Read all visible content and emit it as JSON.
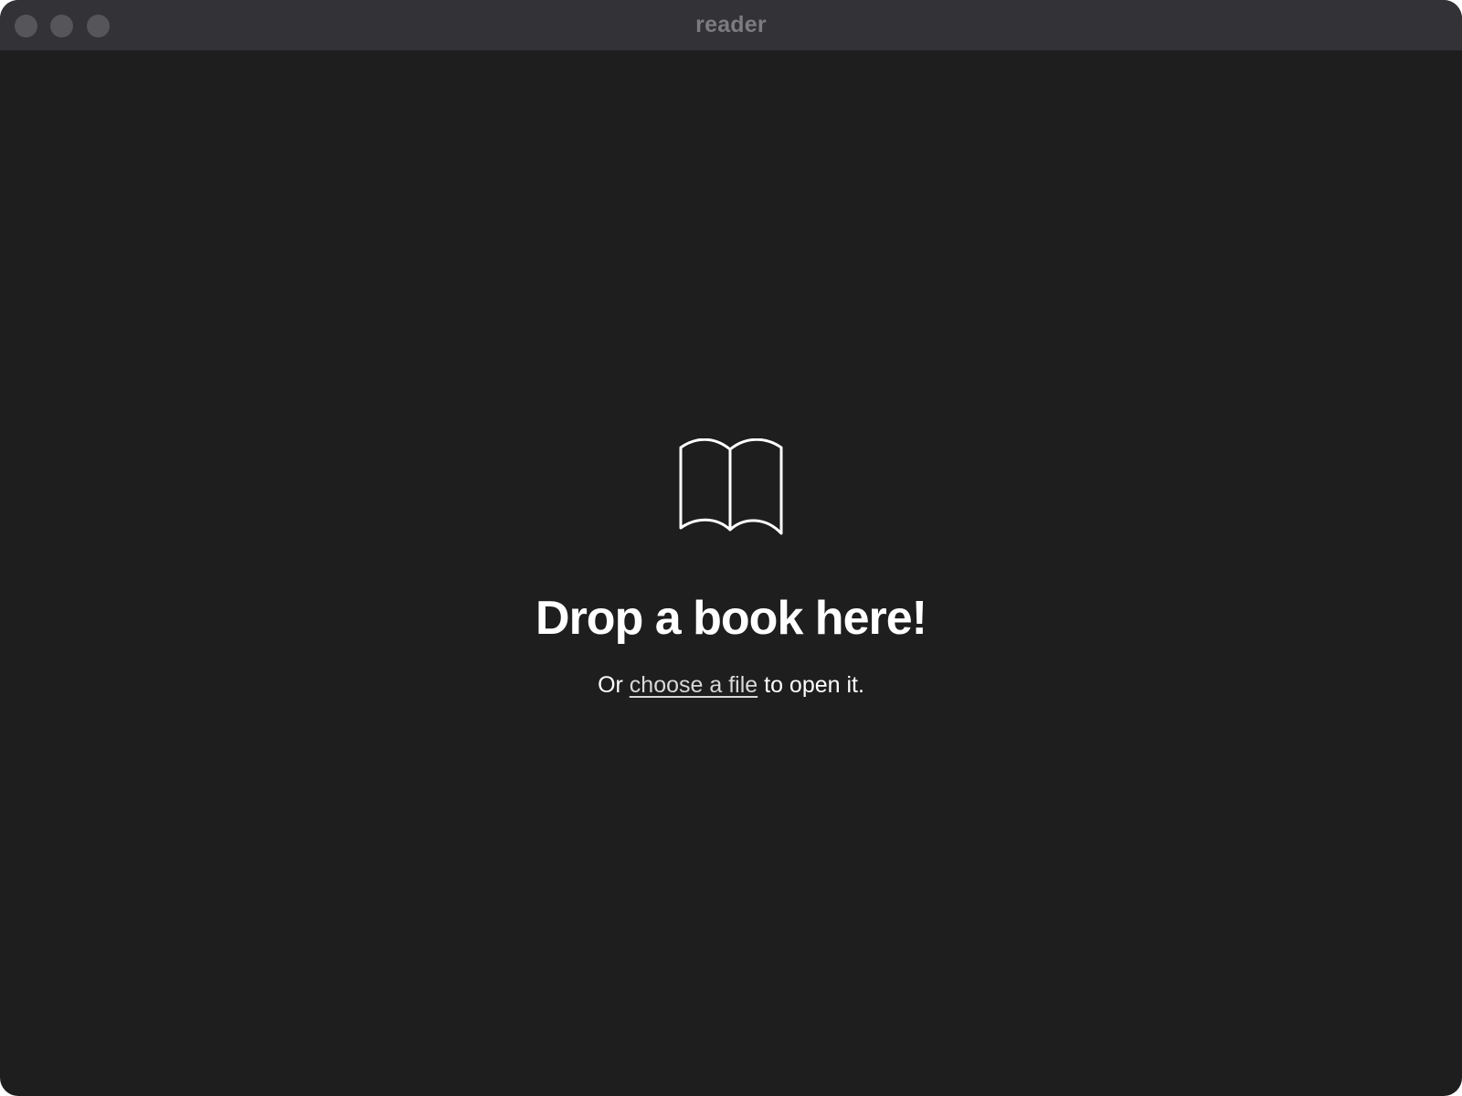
{
  "window": {
    "title": "reader",
    "background": "#1e1e1e",
    "titlebar_background": "#323237",
    "traffic_lights": [
      "close",
      "minimize",
      "zoom"
    ]
  },
  "empty_state": {
    "icon": "open-book-icon",
    "heading": "Drop a book here!",
    "subtitle_prefix": "Or ",
    "link_label": "choose a file",
    "subtitle_suffix": " to open it."
  }
}
